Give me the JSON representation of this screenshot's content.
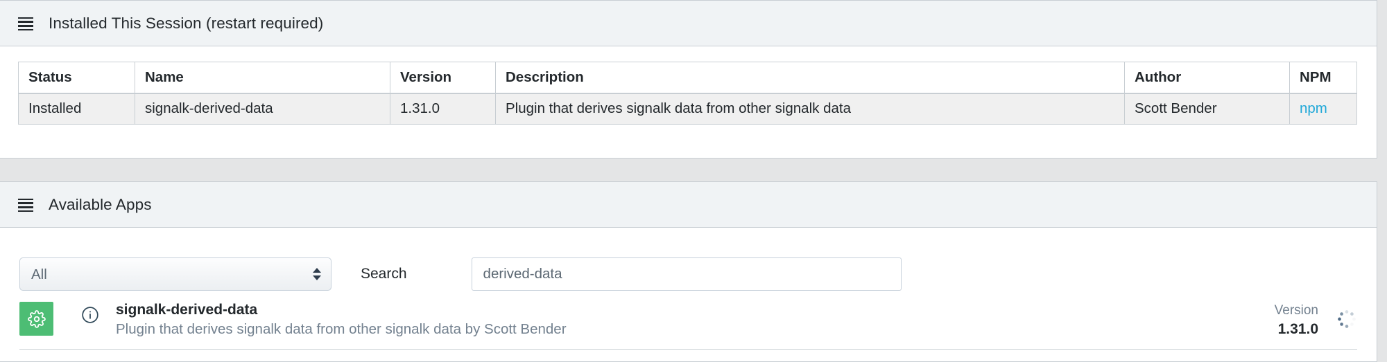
{
  "installed_section": {
    "title": "Installed This Session (restart required)",
    "menu_icon": "hamburger-icon",
    "table": {
      "headers": [
        "Status",
        "Name",
        "Version",
        "Description",
        "Author",
        "NPM"
      ],
      "rows": [
        {
          "status": "Installed",
          "name": "signalk-derived-data",
          "version": "1.31.0",
          "description": "Plugin that derives signalk data from other signalk data",
          "author": "Scott Bender",
          "npm": "npm"
        }
      ]
    }
  },
  "available_section": {
    "title": "Available Apps",
    "menu_icon": "hamburger-icon",
    "filter": {
      "select_value": "All",
      "select_options": [
        "All"
      ],
      "search_label": "Search",
      "search_value": "derived-data",
      "search_placeholder": "Search"
    },
    "apps": [
      {
        "install_icon": "gear-icon",
        "info_icon": "info-circle-icon",
        "name": "signalk-derived-data",
        "description": "Plugin that derives signalk data from other signalk data by Scott Bender",
        "version_label": "Version",
        "version_value": "1.31.0",
        "status_icon": "loading-spinner-icon"
      }
    ]
  },
  "colors": {
    "accent_green": "#4dbd74",
    "link_blue": "#20a8d8",
    "muted_text": "#73818f",
    "border": "#c8ced3",
    "page_bg": "#e4e5e6",
    "header_bg": "#f0f3f5"
  }
}
